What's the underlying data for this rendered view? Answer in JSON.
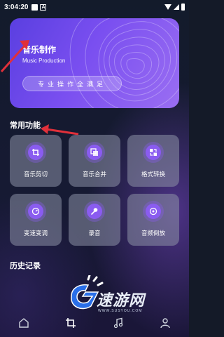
{
  "status_bar": {
    "time": "3:04:20",
    "icon_a": "A"
  },
  "banner": {
    "title": "音乐制作",
    "subtitle": "Music Production",
    "pill": "专业操作全满足"
  },
  "common": {
    "title": "常用功能",
    "tiles": [
      {
        "label": "音乐剪切",
        "icon": "crop-icon"
      },
      {
        "label": "音乐合并",
        "icon": "merge-icon"
      },
      {
        "label": "格式转换",
        "icon": "convert-icon"
      },
      {
        "label": "变速变调",
        "icon": "speed-dial-icon"
      },
      {
        "label": "录音",
        "icon": "microphone-icon"
      },
      {
        "label": "音频倒放",
        "icon": "reverse-disc-icon"
      }
    ]
  },
  "history": {
    "title": "历史记录"
  },
  "watermark": {
    "brand": "速游网",
    "url": "WWW.SUSYOU.COM"
  },
  "colors": {
    "accent": "#8a5cf0",
    "arrow": "#e0303a"
  }
}
